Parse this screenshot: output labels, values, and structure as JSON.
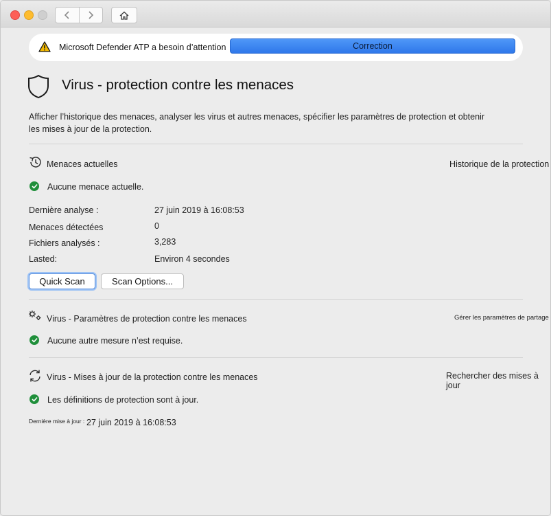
{
  "banner": {
    "message": "Microsoft Defender ATP a besoin d’attention",
    "button_label": "Correction"
  },
  "page": {
    "title": "Virus - protection contre les menaces",
    "description": "Afficher l’historique des menaces, analyser les virus et autres menaces, spécifier les paramètres de protection et obtenir les mises à jour de la protection."
  },
  "current_threats": {
    "title": "Menaces actuelles",
    "link": "Historique de la protection",
    "status": "Aucune menace actuelle.",
    "rows": [
      {
        "label": "Dernière analyse :",
        "value": "27 juin 2019 à 16:08:53"
      },
      {
        "label": "Menaces détectées",
        "value": "0"
      },
      {
        "label": "Fichiers analysés :",
        "value": "3,283"
      },
      {
        "label": "Lasted:",
        "value": "Environ 4 secondes"
      }
    ],
    "quick_scan_label": "Quick Scan",
    "scan_options_label": "Scan Options..."
  },
  "settings": {
    "title": "Virus - Paramètres de protection contre les menaces",
    "link": "Gérer les paramètres de partage",
    "status": "Aucune autre mesure n’est requise."
  },
  "updates": {
    "title": "Virus - Mises à jour de la protection contre les menaces",
    "link": "Rechercher des mises à jour",
    "status": "Les définitions de protection sont à jour.",
    "last_update_label": "Dernière mise à jour :",
    "last_update_value": "27 juin 2019 à 16:08:53"
  },
  "icons": {
    "warning": "warning-icon",
    "shield": "shield-icon",
    "history": "history-icon",
    "settings": "gears-icon",
    "update": "refresh-icon",
    "check": "check-circle-icon"
  },
  "colors": {
    "accent": "#2f78ea",
    "success": "#1f8f3a",
    "warning": "#f2b800"
  }
}
